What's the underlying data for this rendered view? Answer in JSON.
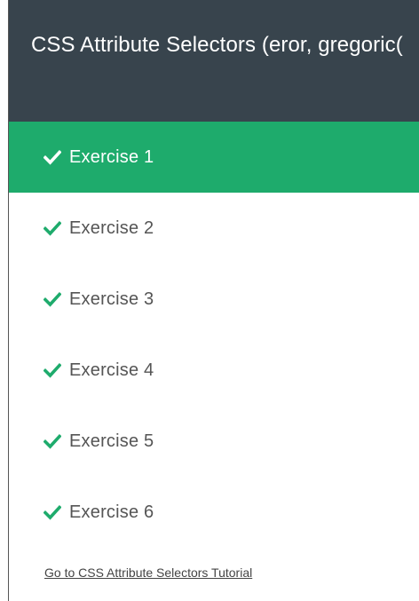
{
  "header": {
    "title": "CSS Attribute Selectors (eror, gregoric("
  },
  "exercises": [
    {
      "label": "Exercise 1",
      "active": true
    },
    {
      "label": "Exercise 2",
      "active": false
    },
    {
      "label": "Exercise 3",
      "active": false
    },
    {
      "label": "Exercise 4",
      "active": false
    },
    {
      "label": "Exercise 5",
      "active": false
    },
    {
      "label": "Exercise 6",
      "active": false
    }
  ],
  "footer": {
    "tutorial_link": "Go to CSS Attribute Selectors Tutorial"
  },
  "colors": {
    "header_bg": "#38444d",
    "active_bg": "#1eab6c",
    "check": "#1eab6c"
  },
  "icons": {
    "check": "checkmark-icon"
  }
}
